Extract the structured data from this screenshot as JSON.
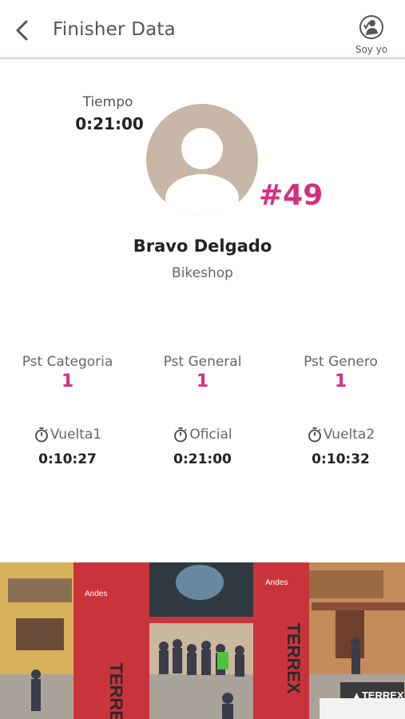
{
  "header": {
    "title": "Finisher Data",
    "soy_yo_label": "Soy yo"
  },
  "profile": {
    "tiempo_label": "Tiempo",
    "tiempo_value": "0:21:00",
    "bib": "#49",
    "name": "Bravo Delgado",
    "club": "Bikeshop"
  },
  "positions": [
    {
      "label": "Pst Categoria",
      "value": "1"
    },
    {
      "label": "Pst General",
      "value": "1"
    },
    {
      "label": "Pst Genero",
      "value": "1"
    }
  ],
  "laps": [
    {
      "label": "Vuelta1",
      "value": "0:10:27"
    },
    {
      "label": "Oficial",
      "value": "0:21:00"
    },
    {
      "label": "Vuelta2",
      "value": "0:10:32"
    }
  ],
  "photo": {
    "arch_brand": "TERREX",
    "sponsor_left": "Andes",
    "sponsor_right": "Andes",
    "banner_text": "TERREX"
  },
  "colors": {
    "accent": "#d2317f",
    "avatar_bg": "#c8b6a6",
    "divider": "#e8c7d4"
  }
}
